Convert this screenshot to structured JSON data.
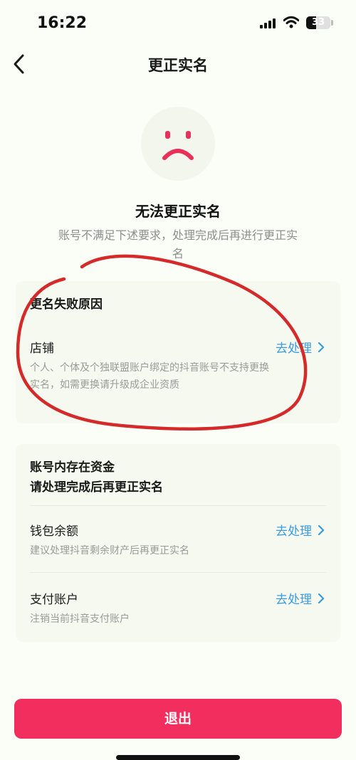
{
  "status_bar": {
    "time": "16:22",
    "battery_level": "33",
    "icons": [
      "signal-icon",
      "wifi-icon",
      "battery-icon"
    ]
  },
  "nav": {
    "title": "更正实名",
    "back_icon": "chevron-left-icon"
  },
  "hero": {
    "icon": "sad-face-icon",
    "title": "无法更正实名",
    "description": "账号不满足下述要求，处理完成后再进行更正实名"
  },
  "failure_card": {
    "heading": "更名失败原因",
    "items": [
      {
        "title": "店铺",
        "action": "去处理",
        "description": "个人、个体及个独联盟账户绑定的抖音账号不支持更换实名，如需更换请升级成企业资质"
      }
    ]
  },
  "funds_card": {
    "heading_line1": "账号内存在资金",
    "heading_line2": "请处理完成后再更正实名",
    "items": [
      {
        "title": "钱包余额",
        "action": "去处理",
        "description": "建议处理抖音剩余财产后再更正实名"
      },
      {
        "title": "支付账户",
        "action": "去处理",
        "description": "注销当前抖音支付账户"
      }
    ]
  },
  "footer": {
    "exit_label": "退出"
  },
  "colors": {
    "accent_link": "#3b9be0",
    "exit_button": "#f22e5e",
    "sad_face": "#e8305a",
    "annotation": "#d42a2a",
    "background": "#fbfdf7",
    "card": "#f6f9ef"
  }
}
